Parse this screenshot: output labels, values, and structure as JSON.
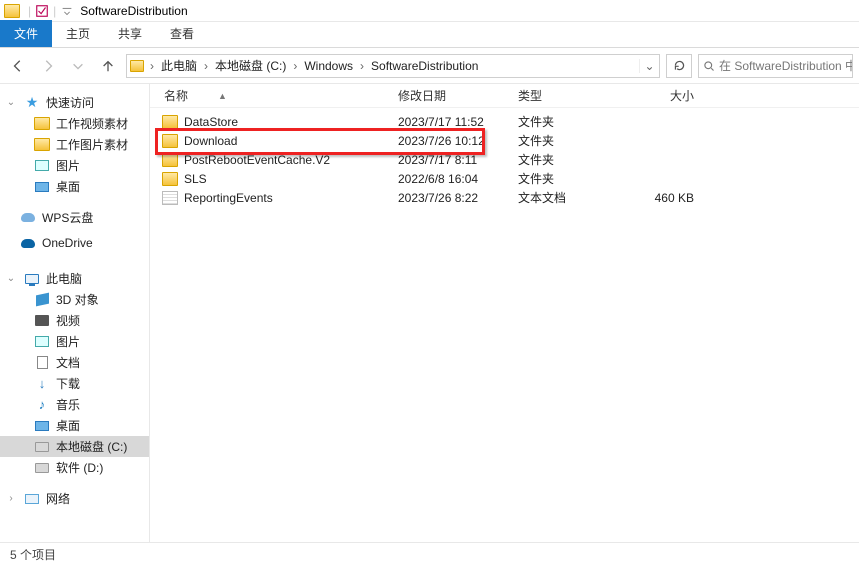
{
  "window": {
    "title": "SoftwareDistribution"
  },
  "tabs": {
    "file": "文件",
    "home": "主页",
    "share": "共享",
    "view": "查看"
  },
  "breadcrumbs": [
    "此电脑",
    "本地磁盘 (C:)",
    "Windows",
    "SoftwareDistribution"
  ],
  "search": {
    "placeholder": "在 SoftwareDistribution 中"
  },
  "columns": {
    "name": "名称",
    "date": "修改日期",
    "type": "类型",
    "size": "大小"
  },
  "sidebar": {
    "quick": {
      "label": "快速访问",
      "items": [
        {
          "label": "工作视频素材",
          "icon": "folder"
        },
        {
          "label": "工作图片素材",
          "icon": "folder"
        },
        {
          "label": "图片",
          "icon": "pic"
        },
        {
          "label": "桌面",
          "icon": "desk"
        }
      ]
    },
    "clouds": [
      {
        "label": "WPS云盘",
        "icon": "cloud"
      },
      {
        "label": "OneDrive",
        "icon": "cloud-blue"
      }
    ],
    "pc": {
      "label": "此电脑",
      "items": [
        {
          "label": "3D 对象",
          "icon": "3d"
        },
        {
          "label": "视频",
          "icon": "vid"
        },
        {
          "label": "图片",
          "icon": "pic"
        },
        {
          "label": "文档",
          "icon": "doc"
        },
        {
          "label": "下载",
          "icon": "down"
        },
        {
          "label": "音乐",
          "icon": "music"
        },
        {
          "label": "桌面",
          "icon": "desk"
        },
        {
          "label": "本地磁盘 (C:)",
          "icon": "disk",
          "selected": true
        },
        {
          "label": "软件 (D:)",
          "icon": "disk"
        }
      ]
    },
    "network": {
      "label": "网络"
    }
  },
  "files": [
    {
      "name": "DataStore",
      "date": "2023/7/17 11:52",
      "type": "文件夹",
      "size": "",
      "icon": "folder"
    },
    {
      "name": "Download",
      "date": "2023/7/26 10:12",
      "type": "文件夹",
      "size": "",
      "icon": "folder",
      "highlighted": true
    },
    {
      "name": "PostRebootEventCache.V2",
      "date": "2023/7/17 8:11",
      "type": "文件夹",
      "size": "",
      "icon": "folder"
    },
    {
      "name": "SLS",
      "date": "2022/6/8 16:04",
      "type": "文件夹",
      "size": "",
      "icon": "folder"
    },
    {
      "name": "ReportingEvents",
      "date": "2023/7/26 8:22",
      "type": "文本文档",
      "size": "460 KB",
      "icon": "text"
    }
  ],
  "status": {
    "count": "5 个项目"
  }
}
